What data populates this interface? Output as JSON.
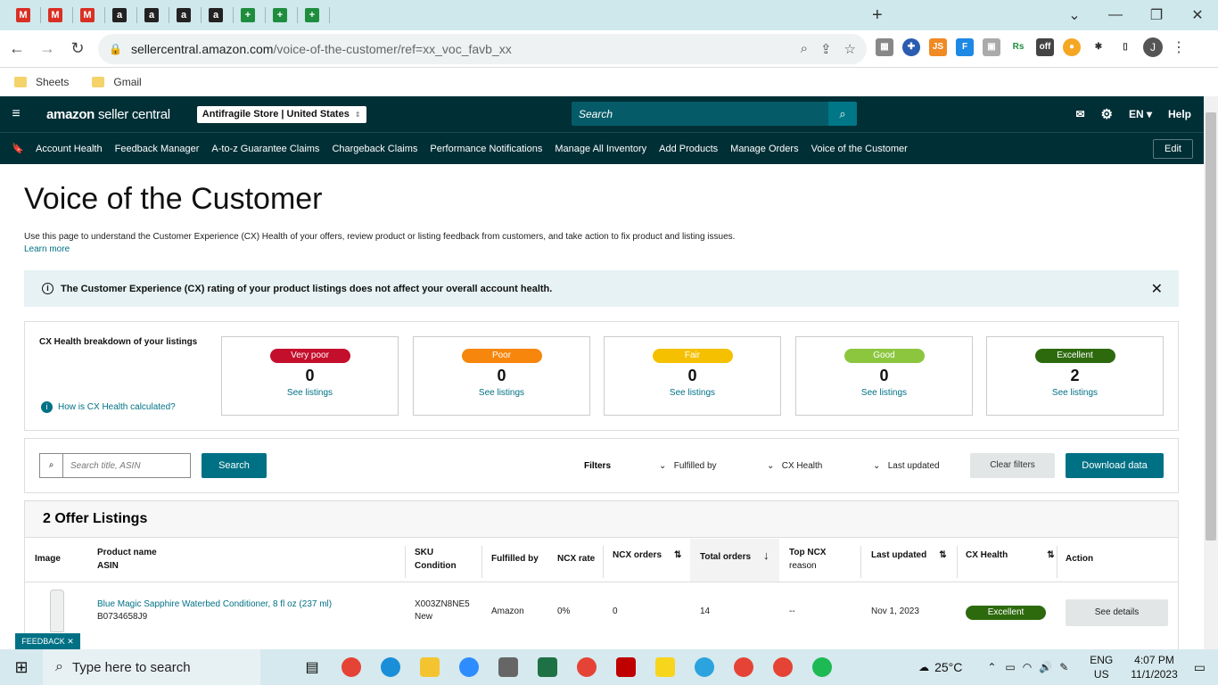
{
  "browser": {
    "tab_icons": [
      {
        "name": "gmail-icon",
        "color": "#d93025",
        "char": "M"
      },
      {
        "name": "gmail-icon",
        "color": "#d93025",
        "char": "M"
      },
      {
        "name": "gmail-icon",
        "color": "#d93025",
        "char": "M"
      },
      {
        "name": "amazon-icon",
        "color": "#222",
        "char": "a"
      },
      {
        "name": "amazon-icon",
        "color": "#222",
        "char": "a"
      },
      {
        "name": "amazon-icon",
        "color": "#222",
        "char": "a"
      },
      {
        "name": "amazon-icon",
        "color": "#222",
        "char": "a"
      },
      {
        "name": "sheets-icon",
        "color": "#1e8e3e",
        "char": "+"
      },
      {
        "name": "sheets-icon",
        "color": "#1e8e3e",
        "char": "+"
      },
      {
        "name": "sheets-icon",
        "color": "#1e8e3e",
        "char": "+"
      }
    ],
    "window_controls": {
      "minimize": "—",
      "maximize": "❐",
      "close": "✕",
      "chevron": "⌄"
    },
    "url_domain": "sellercentral.amazon.com",
    "url_path": "/voice-of-the-customer/ref=xx_voc_favb_xx",
    "profile_initial": "J",
    "bookmarks": [
      "Sheets",
      "Gmail"
    ]
  },
  "seller": {
    "logo_main": "amazon",
    "logo_sub": "seller central",
    "store": "Antifragile Store | United States",
    "search_placeholder": "Search",
    "lang": "EN",
    "help": "Help",
    "nav": [
      "Account Health",
      "Feedback Manager",
      "A-to-z Guarantee Claims",
      "Chargeback Claims",
      "Performance Notifications",
      "Manage All Inventory",
      "Add Products",
      "Manage Orders",
      "Voice of the Customer"
    ],
    "edit": "Edit"
  },
  "page": {
    "title": "Voice of the Customer",
    "intro": "Use this page to understand the Customer Experience (CX) Health of your offers, review product or listing feedback from customers, and take action to fix product and listing issues.",
    "learn_more": "Learn more",
    "banner": "The Customer Experience (CX) rating of your product listings does not affect your overall account health."
  },
  "cx": {
    "title": "CX Health breakdown of your listings",
    "how": "How is CX Health calculated?",
    "cards": [
      {
        "label": "Very poor",
        "count": "0",
        "link": "See listings",
        "color": "#c40f2c"
      },
      {
        "label": "Poor",
        "count": "0",
        "link": "See listings",
        "color": "#f7860c"
      },
      {
        "label": "Fair",
        "count": "0",
        "link": "See listings",
        "color": "#f5c000"
      },
      {
        "label": "Good",
        "count": "0",
        "link": "See listings",
        "color": "#8cc63f"
      },
      {
        "label": "Excellent",
        "count": "2",
        "link": "See listings",
        "color": "#2d6a0e"
      }
    ]
  },
  "filters": {
    "search_placeholder": "Search title, ASIN",
    "search_button": "Search",
    "label": "Filters",
    "fulfilled_by": "Fulfilled by",
    "cx_health": "CX Health",
    "last_updated": "Last updated",
    "clear": "Clear filters",
    "download": "Download data"
  },
  "listings": {
    "title": "2 Offer Listings",
    "headers": {
      "image": "Image",
      "product": "Product name",
      "asin": "ASIN",
      "sku": "SKU",
      "condition": "Condition",
      "fulfilled": "Fulfilled by",
      "ncx_rate": "NCX rate",
      "ncx_orders": "NCX orders",
      "total_orders": "Total orders",
      "top_ncx": "Top NCX",
      "reason": "reason",
      "last_updated": "Last updated",
      "cx_health": "CX Health",
      "action": "Action"
    },
    "rows": [
      {
        "product": "Blue Magic Sapphire Waterbed Conditioner, 8 fl oz (237 ml)",
        "asin": "B0734658J9",
        "sku": "X003ZN8NE5",
        "condition": "New",
        "fulfilled": "Amazon",
        "ncx_rate": "0%",
        "ncx_orders": "0",
        "total_orders": "14",
        "top_ncx": "--",
        "last_updated": "Nov 1, 2023",
        "cx_health": "Excellent",
        "action": "See details"
      }
    ]
  },
  "feedback": "FEEDBACK ✕",
  "taskbar": {
    "search_placeholder": "Type here to search",
    "weather": "25°C",
    "lang1": "ENG",
    "lang2": "US",
    "time": "4:07 PM",
    "date": "11/1/2023"
  }
}
